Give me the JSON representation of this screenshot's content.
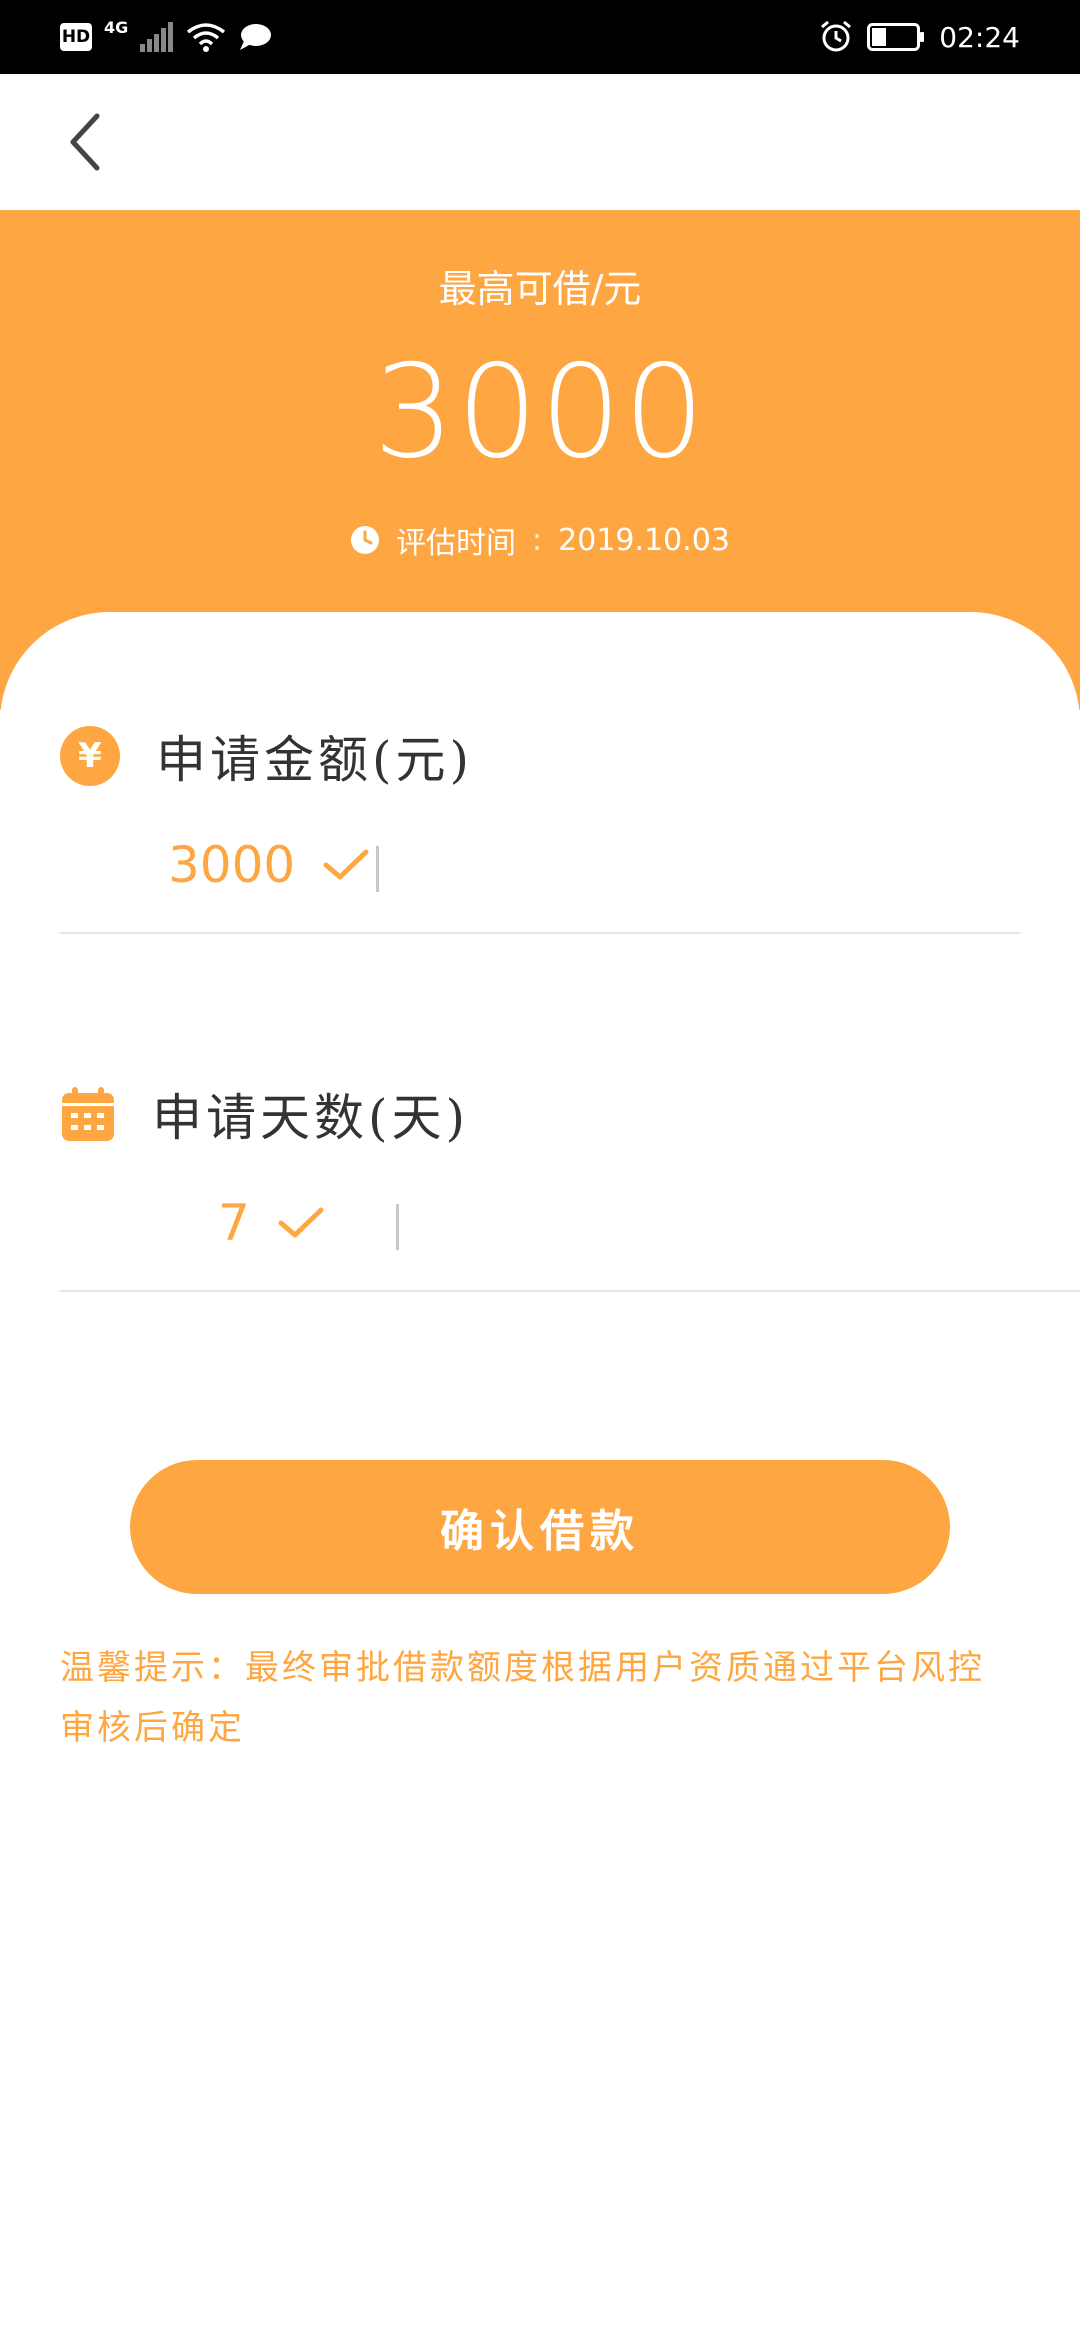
{
  "status_bar": {
    "network_badge": "HD",
    "network_type": "4G",
    "time": "02:24",
    "icons": [
      "signal-icon",
      "wifi-icon",
      "message-icon",
      "alarm-icon",
      "battery-icon"
    ]
  },
  "nav": {
    "back_icon": "chevron-left-icon"
  },
  "header": {
    "label": "最高可借/元",
    "amount": "3000",
    "eval_label": "评估时间",
    "eval_sep": ":",
    "eval_date": "2019.10.03"
  },
  "amount_field": {
    "title": "申请金额(元)",
    "icon": "yen-icon",
    "symbol": "¥",
    "value": "3000"
  },
  "days_field": {
    "title": "申请天数(天)",
    "icon": "calendar-icon",
    "value": "7"
  },
  "confirm_button": {
    "label": "确认借款"
  },
  "tip": {
    "text": "温馨提示：最终审批借款额度根据用户资质通过平台风控审核后确定"
  },
  "colors": {
    "accent": "#fea742",
    "status_bar": "#000000",
    "divider": "#e6e6e6"
  }
}
